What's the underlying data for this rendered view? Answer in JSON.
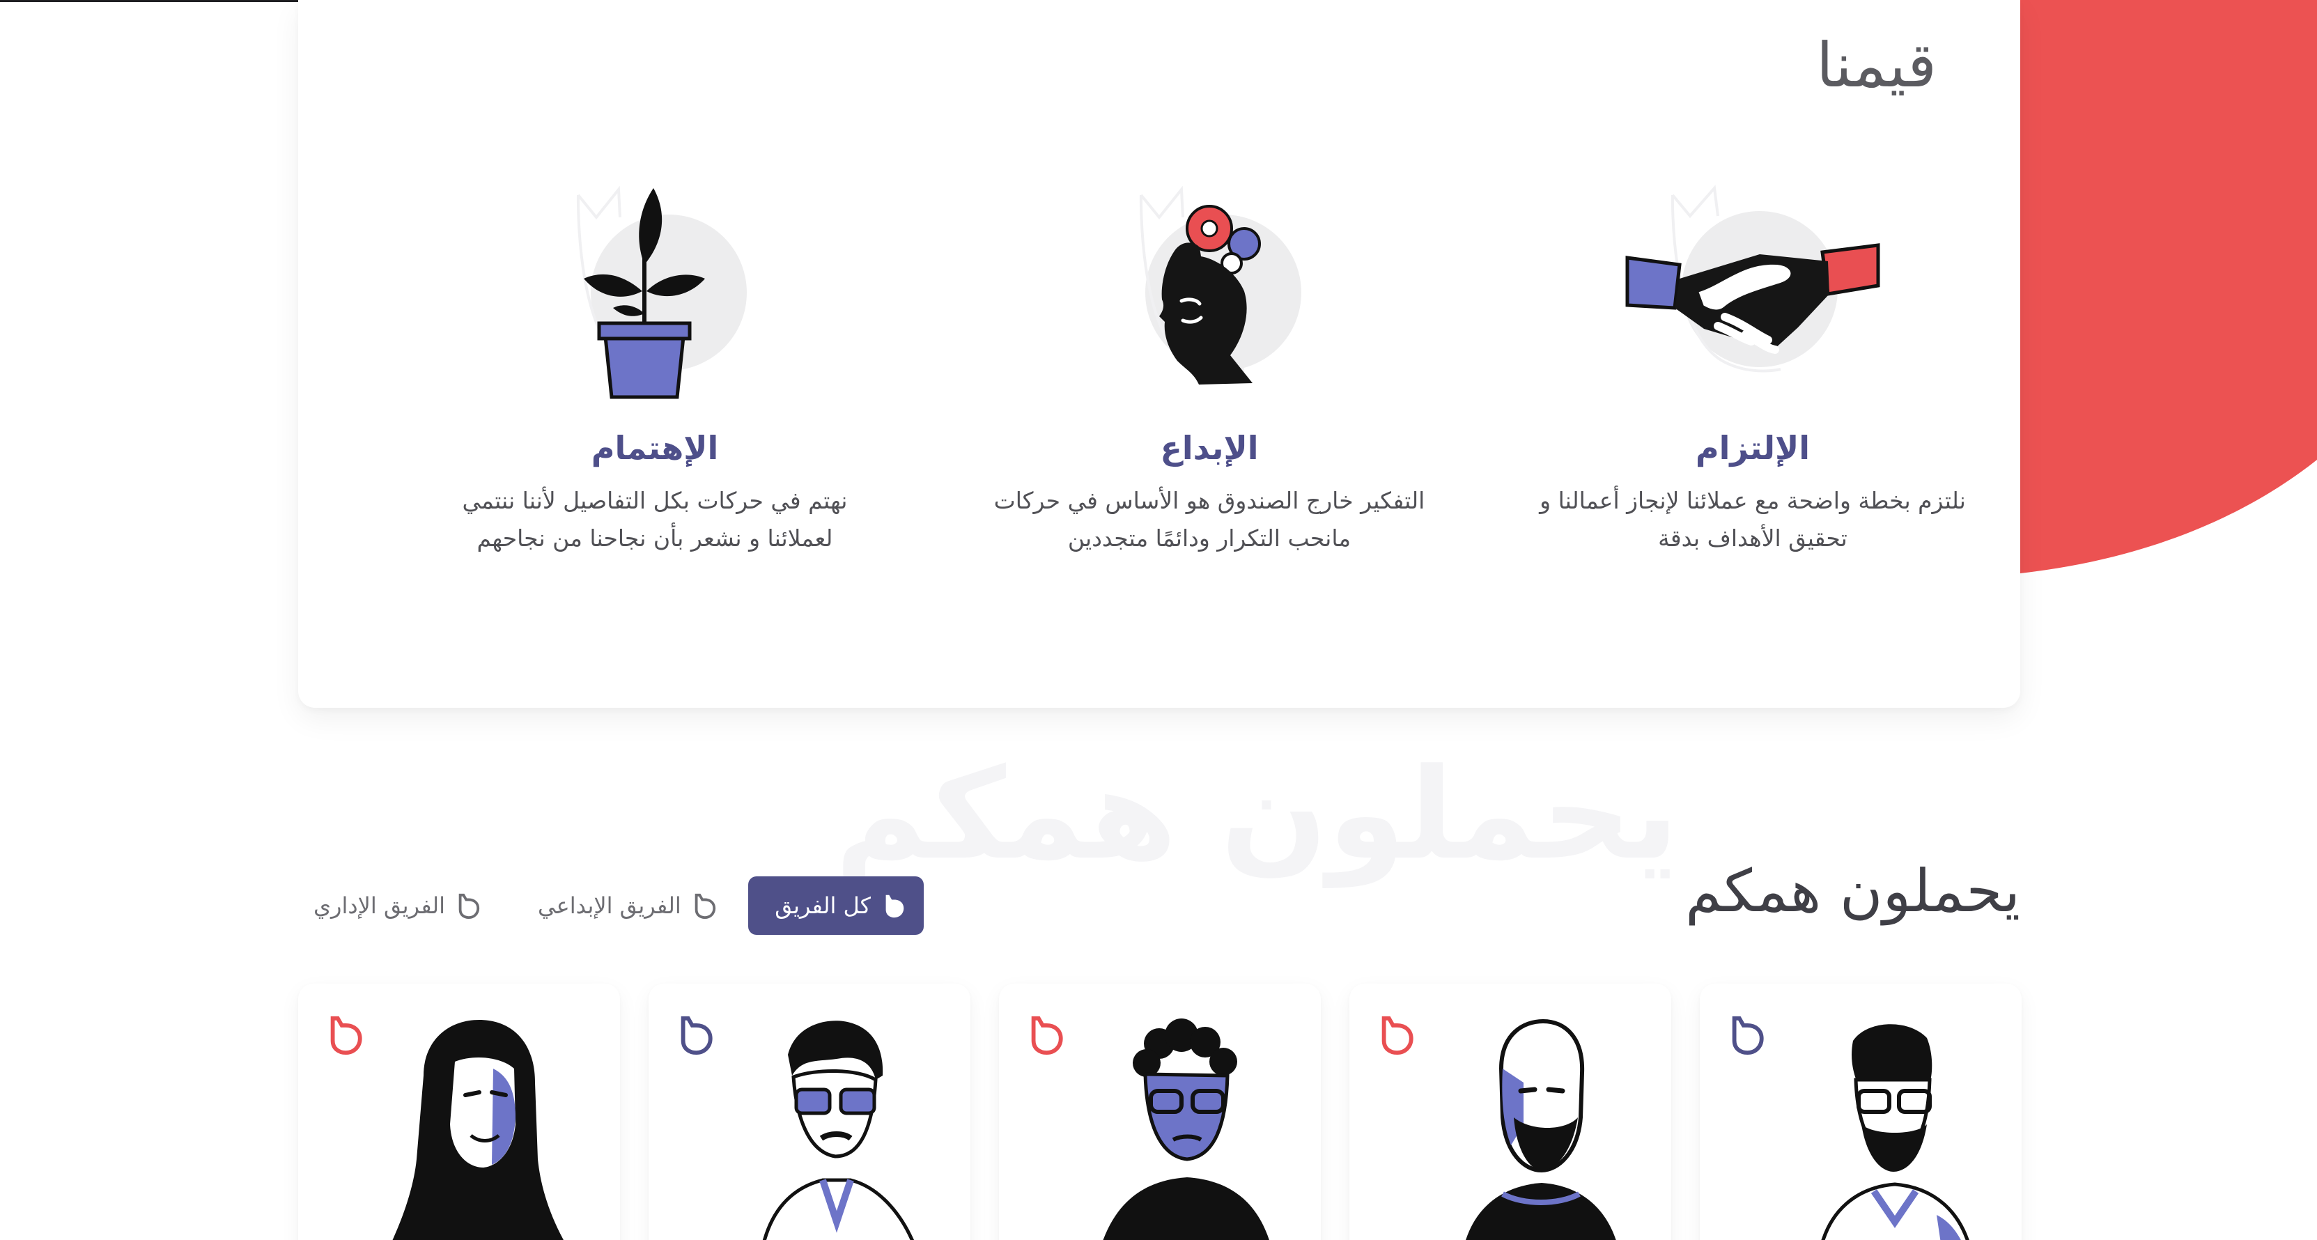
{
  "values": {
    "title": "قيمنا",
    "items": [
      {
        "heading": "الإلتزام",
        "line1": "نلتزم بخطة واضحة مع عملائنا لإنجاز أعمالنا و",
        "line2": "تحقيق الأهداف بدقة",
        "icon": "handshake-icon"
      },
      {
        "heading": "الإبداع",
        "line1": "التفكير خارج الصندوق هو الأساس في حركات",
        "line2": "مانحب التكرار ودائمًا متجددين",
        "icon": "creative-head-icon"
      },
      {
        "heading": "الإهتمام",
        "line1": "نهتم في حركات بكل التفاصيل لأننا ننتمي",
        "line2": "لعملائنا و نشعر بأن نجاحنا من نجاحهم",
        "icon": "plant-pot-icon"
      }
    ]
  },
  "team": {
    "title": "يحملون همكم",
    "watermark": "يحملون همكم",
    "filters": [
      {
        "label": "كل الفريق",
        "active": true
      },
      {
        "label": "الفريق الإبداعي",
        "active": false
      },
      {
        "label": "الفريق الإداري",
        "active": false
      }
    ],
    "members": [
      {
        "icon": "man-glasses-beard-portrait",
        "mark_color": "#4f5089"
      },
      {
        "icon": "bald-man-portrait",
        "mark_color": "#e94f52"
      },
      {
        "icon": "curly-hair-man-portrait",
        "mark_color": "#e94f52"
      },
      {
        "icon": "man-glasses-portrait",
        "mark_color": "#4f5089"
      },
      {
        "icon": "woman-hijab-portrait",
        "mark_color": "#e94f52"
      }
    ]
  },
  "colors": {
    "accent_red": "#ec5252",
    "brand_indigo": "#4f5089",
    "portrait_blue": "#6d74c8"
  }
}
